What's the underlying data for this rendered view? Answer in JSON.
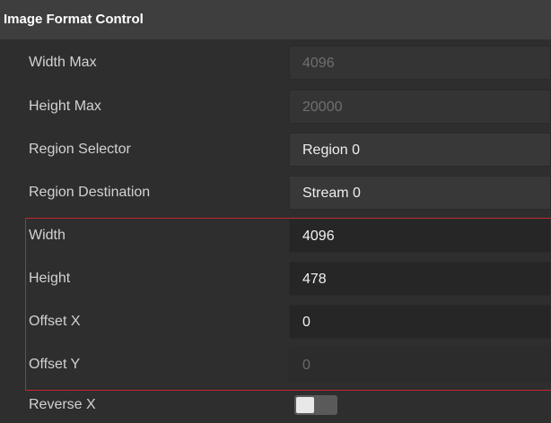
{
  "section": {
    "title": "Image Format Control"
  },
  "rows": [
    {
      "label": "Width Max",
      "value": "4096",
      "disabled": true
    },
    {
      "label": "Height Max",
      "value": "20000",
      "disabled": true
    },
    {
      "label": "Region Selector",
      "value": "Region 0",
      "disabled": false
    },
    {
      "label": "Region Destination",
      "value": "Stream 0",
      "disabled": false
    },
    {
      "label": "Width",
      "value": "4096",
      "disabled": false
    },
    {
      "label": "Height",
      "value": "478",
      "disabled": false
    },
    {
      "label": "Offset X",
      "value": "0",
      "disabled": false
    },
    {
      "label": "Offset Y",
      "value": "0",
      "disabled": true
    }
  ],
  "reverse_x": {
    "label": "Reverse X",
    "enabled": false
  },
  "colors": {
    "background": "#2e2e2e",
    "header": "#3e3e3e",
    "highlight_border": "#c0272d"
  }
}
